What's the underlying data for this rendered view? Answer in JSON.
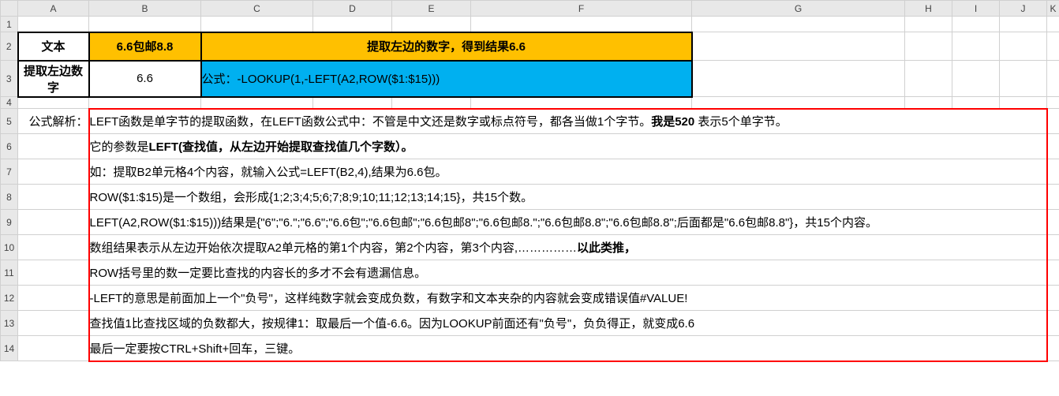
{
  "columns": [
    "A",
    "B",
    "C",
    "D",
    "E",
    "F",
    "G",
    "H",
    "I",
    "J",
    "K"
  ],
  "rows": [
    "1",
    "2",
    "3",
    "4",
    "5",
    "6",
    "7",
    "8",
    "9",
    "10",
    "11",
    "12",
    "13",
    "14"
  ],
  "header": {
    "A2": "文本",
    "B2": "6.6包邮8.8",
    "CF2": "提取左边的数字，得到结果6.6",
    "A3": "提取左边数字",
    "B3": "6.6",
    "CF3": "公式：-LOOKUP(1,-LEFT(A2,ROW($1:$15)))"
  },
  "label_A5": "公式解析：",
  "explain": {
    "r5_a": "LEFT函数是单字节的提取函数，在LEFT函数公式中：不管是中文还是数字或标点符号，都各当做1个字节。",
    "r5_b": "我是520",
    "r5_c": " 表示5个单字节。",
    "r6_a": "它的参数是",
    "r6_b": "LEFT(查找值，从左边开始提取查找值几个字数）。",
    "r7": "如：提取B2单元格4个内容，就输入公式=LEFT(B2,4),结果为6.6包。",
    "r8": "ROW($1:$15)是一个数组，会形成{1;2;3;4;5;6;7;8;9;10;11;12;13;14;15}，共15个数。",
    "r9": "LEFT(A2,ROW($1:$15)))结果是{\"6\";\"6.\";\"6.6\";\"6.6包\";\"6.6包邮\";\"6.6包邮8\";\"6.6包邮8.\";\"6.6包邮8.8\";\"6.6包邮8.8\";后面都是\"6.6包邮8.8\"}，共15个内容。",
    "r10_a": "数组结果表示从左边开始依次提取A2单元格的第1个内容，第2个内容，第3个内容,……………",
    "r10_b": "以此类推，",
    "r11": "ROW括号里的数一定要比查找的内容长的多才不会有遗漏信息。",
    "r12": "-LEFT的意思是前面加上一个\"负号\"，这样纯数字就会变成负数，有数字和文本夹杂的内容就会变成错误值#VALUE!",
    "r13": "查找值1比查找区域的负数都大，按规律1：取最后一个值-6.6。因为LOOKUP前面还有\"负号\"，负负得正，就变成6.6",
    "r14": "最后一定要按CTRL+Shift+回车，三键。"
  },
  "colors": {
    "yellow": "#ffc000",
    "blue": "#00b0f0",
    "red": "#ff0000"
  }
}
